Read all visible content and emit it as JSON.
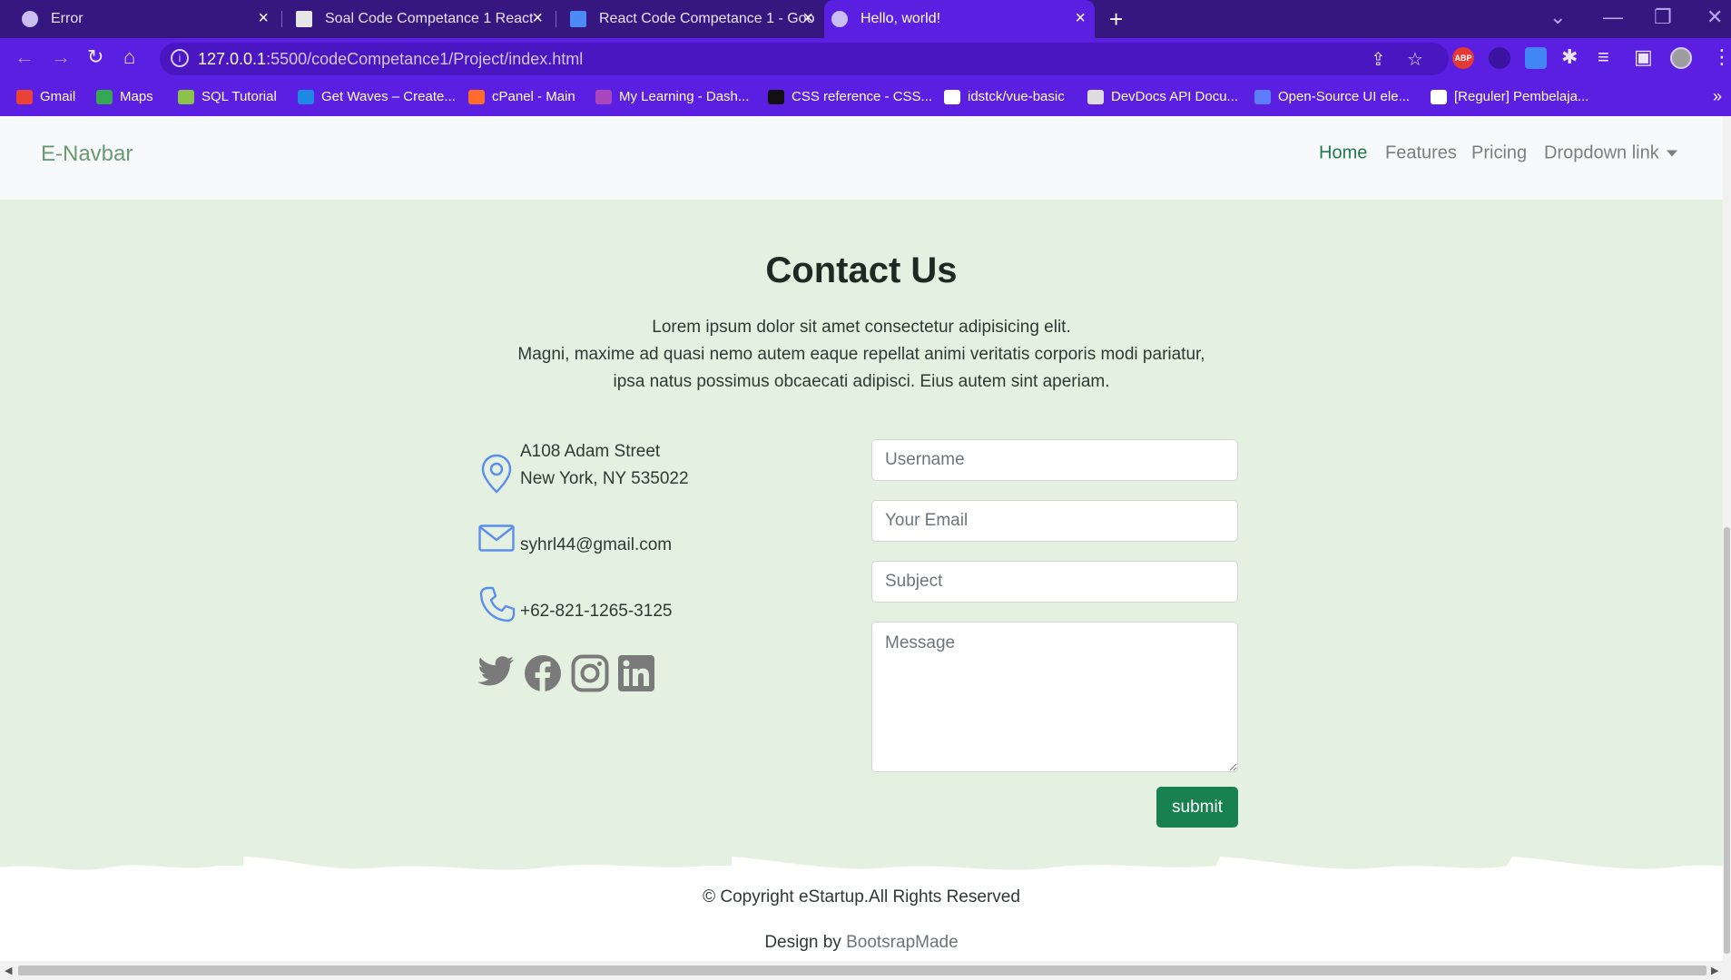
{
  "browser": {
    "tabs": [
      {
        "title": "Error",
        "active": false
      },
      {
        "title": "Soal Code Competance 1 React",
        "active": false
      },
      {
        "title": "React Code Competance 1 - Goo",
        "active": false
      },
      {
        "title": "Hello, world!",
        "active": true
      }
    ],
    "new_tab_symbol": "+",
    "address": {
      "host": "127.0.0.1",
      "rest": ":5500/codeCompetance1/Project/index.html"
    },
    "bookmarks": [
      {
        "label": "Gmail",
        "color": "#ea4335"
      },
      {
        "label": "Maps",
        "color": "#34a853"
      },
      {
        "label": "SQL Tutorial",
        "color": "#8bc34a"
      },
      {
        "label": "Get Waves – Create...",
        "color": "#1e88e5"
      },
      {
        "label": "cPanel - Main",
        "color": "#ff6c2c"
      },
      {
        "label": "My Learning - Dash...",
        "color": "#ab47bc"
      },
      {
        "label": "CSS reference - CSS...",
        "color": "#111111"
      },
      {
        "label": "idstck/vue-basic",
        "color": "#ffffff"
      },
      {
        "label": "DevDocs API Docu...",
        "color": "#dddddd"
      },
      {
        "label": "Open-Source UI ele...",
        "color": "#5c7cfa"
      },
      {
        "label": "[Reguler] Pembelaja...",
        "color": "#ffffff"
      }
    ],
    "more_bookmarks_symbol": "»",
    "extension_badge": "ABP"
  },
  "navbar": {
    "brand": "E-Navbar",
    "links": [
      {
        "label": "Home",
        "active": true
      },
      {
        "label": "Features",
        "active": false
      },
      {
        "label": "Pricing",
        "active": false
      },
      {
        "label": "Dropdown link",
        "active": false
      }
    ]
  },
  "contact": {
    "title": "Contact Us",
    "lead": [
      "Lorem ipsum dolor sit amet consectetur adipisicing elit.",
      "Magni, maxime ad quasi nemo autem eaque repellat animi veritatis corporis modi pariatur,",
      "ipsa natus possimus obcaecati adipisci. Eius autem sint aperiam."
    ],
    "address_line1": "A108 Adam Street",
    "address_line2": "New York, NY 535022",
    "email": "syhrl44@gmail.com",
    "phone": "+62-821-1265-3125",
    "icon_color": "#5b8def",
    "social_color": "#7a7a7a",
    "social": [
      "twitter-icon",
      "facebook-icon",
      "instagram-icon",
      "linkedin-icon"
    ]
  },
  "form": {
    "username_placeholder": "Username",
    "email_placeholder": "Your Email",
    "subject_placeholder": "Subject",
    "message_placeholder": "Message",
    "submit_label": "submit",
    "submit_color": "#17824f"
  },
  "footer": {
    "copyright": "© Copyright eStartup.All Rights Reserved",
    "credit_prefix": "Design by ",
    "credit_link": "BootsrapMade"
  }
}
